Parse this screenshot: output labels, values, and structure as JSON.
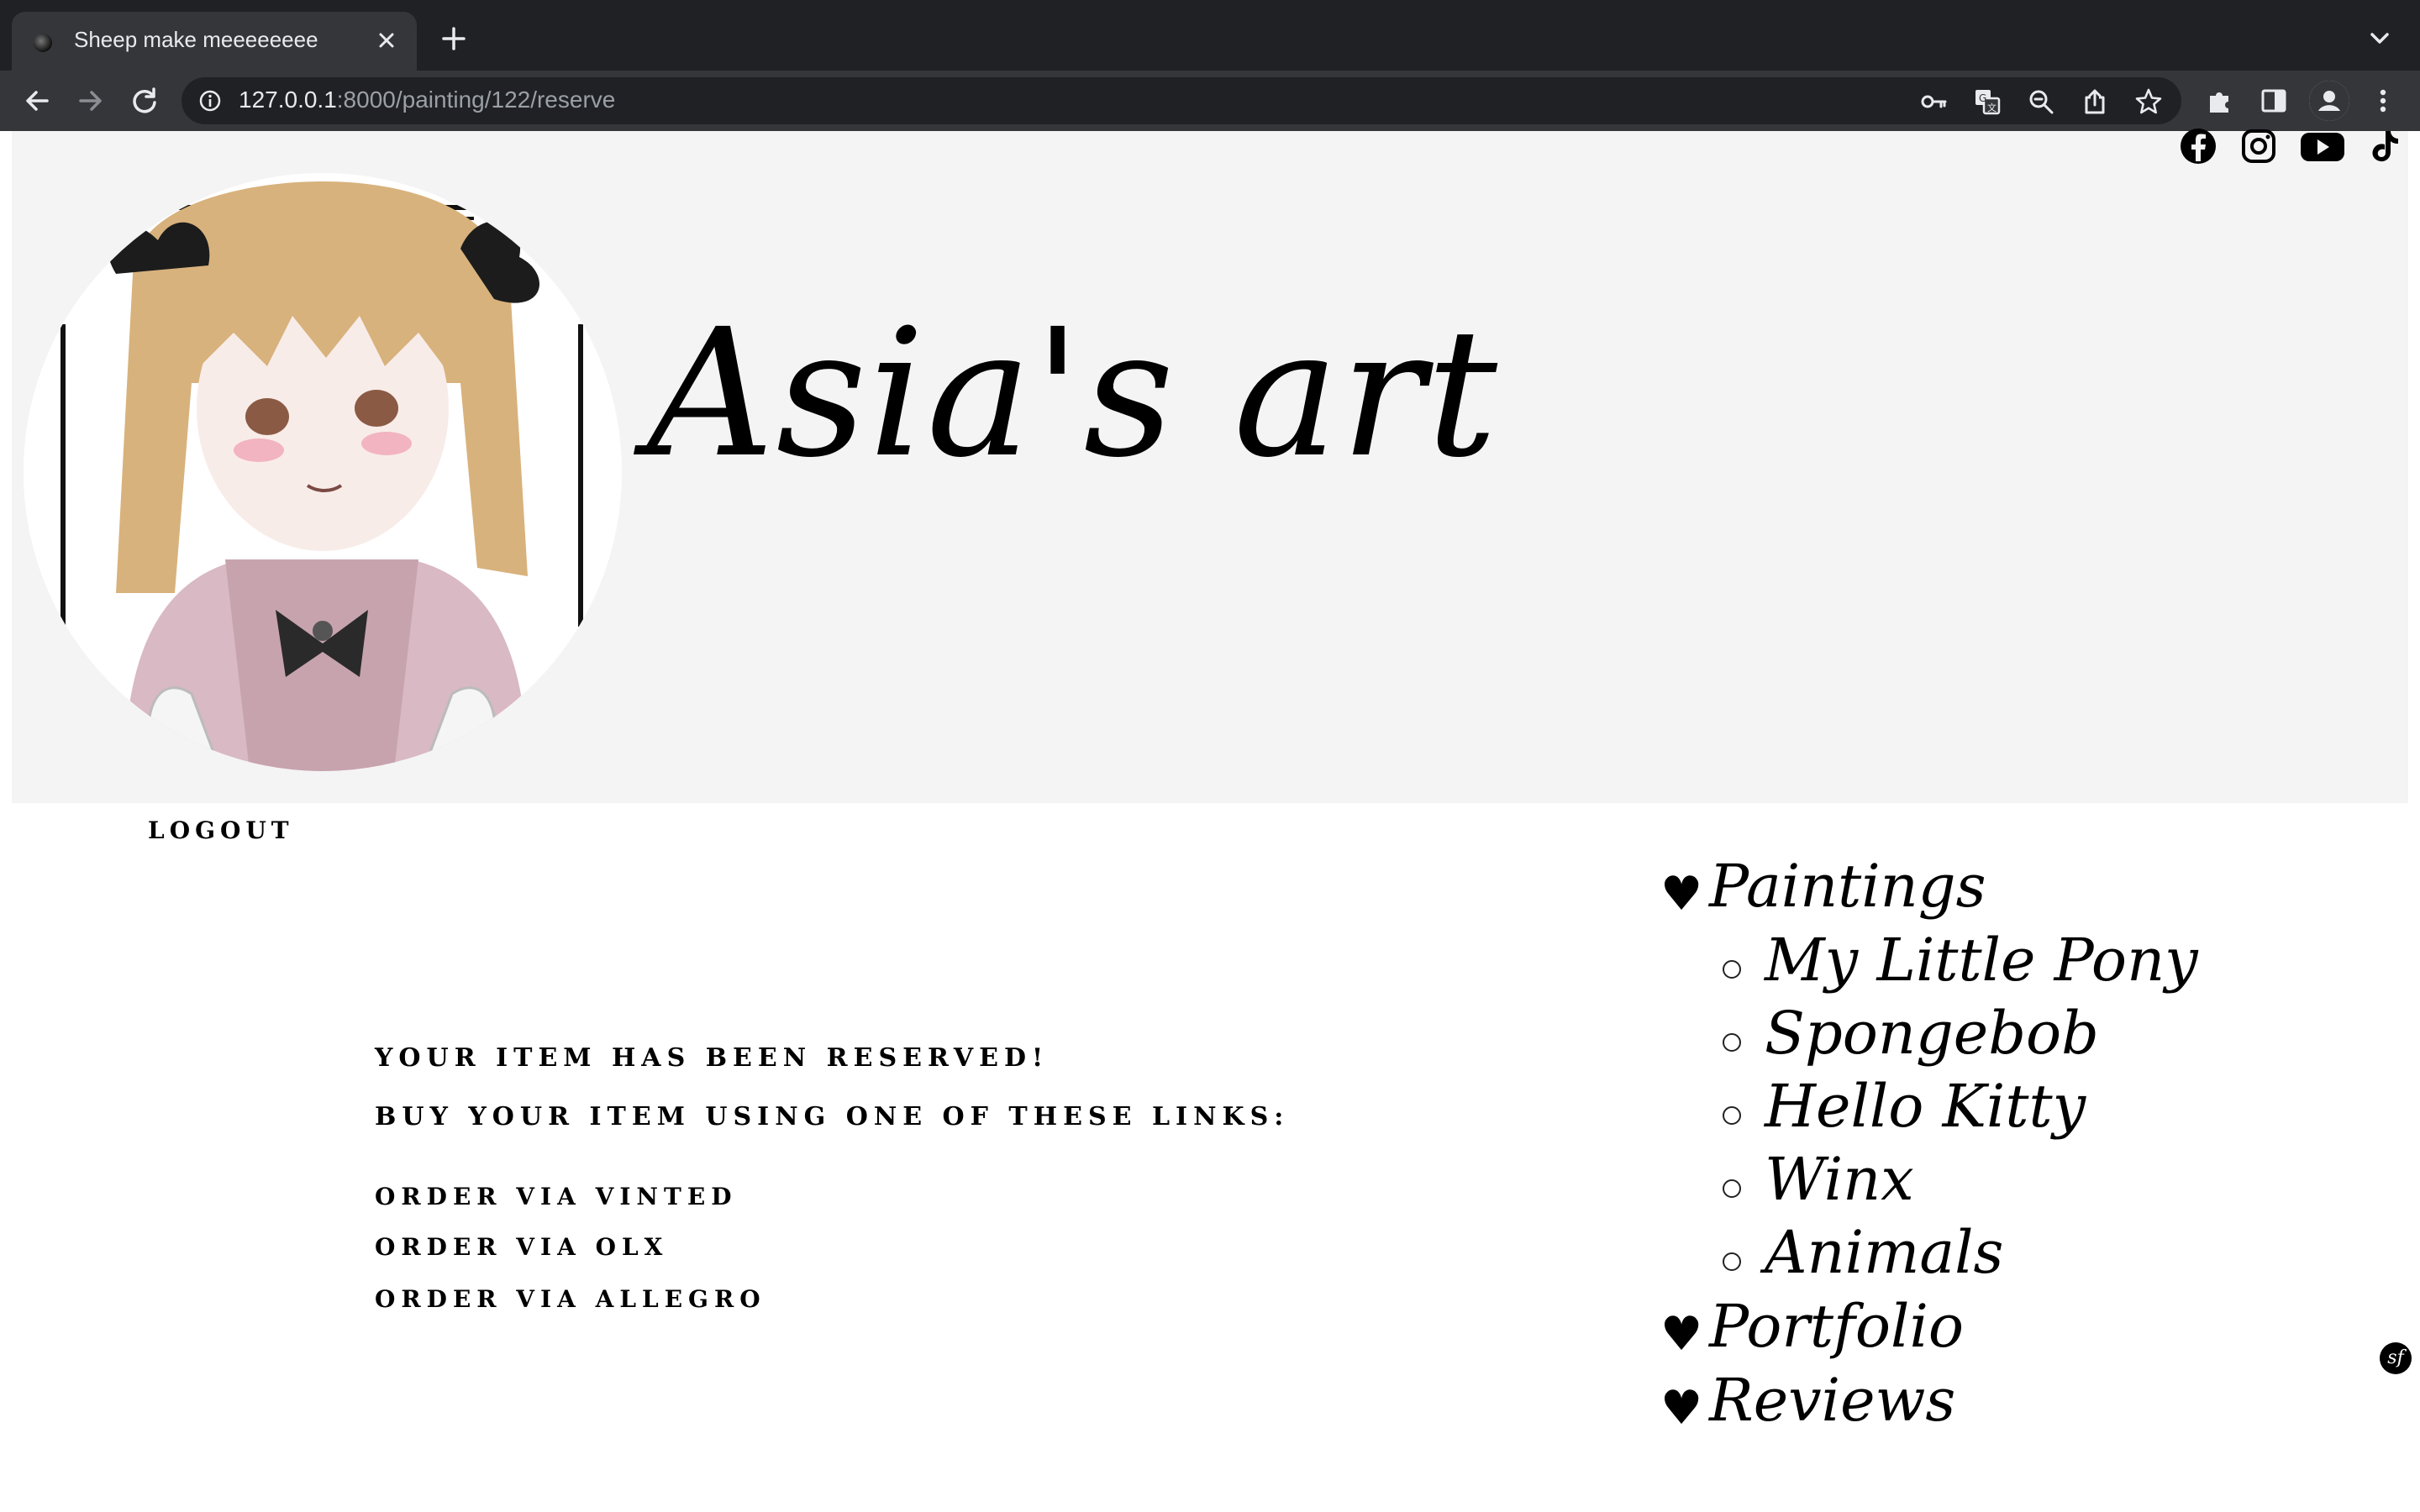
{
  "browser": {
    "tab": {
      "title": "Sheep make meeeeeeee",
      "favicon": "sheep-favicon-icon"
    },
    "url": {
      "host": "127.0.0.1",
      "path": ":8000/painting/122/reserve"
    },
    "icons": [
      "back-arrow-icon",
      "forward-arrow-icon",
      "reload-icon",
      "info-icon",
      "key-icon",
      "translate-icon",
      "zoom-out-icon",
      "share-icon",
      "star-icon",
      "puzzle-icon",
      "side-panel-icon",
      "profile-icon",
      "more-vert-icon",
      "close-icon",
      "plus-icon",
      "chevron-down-icon"
    ]
  },
  "header": {
    "site_title": "Asia's art",
    "social": [
      "facebook-icon",
      "instagram-icon",
      "youtube-icon",
      "tiktok-icon"
    ]
  },
  "auth": {
    "logout_label": "LOGOUT"
  },
  "main": {
    "reserved_message": "YOUR ITEM HAS BEEN RESERVED!",
    "links_intro": "BUY YOUR ITEM USING ONE OF THESE LINKS:",
    "order_links": [
      "ORDER VIA VINTED",
      "ORDER VIA OLX",
      "ORDER VIA ALLEGRO"
    ]
  },
  "menu": {
    "bullet": "♥",
    "items": [
      {
        "label": "Paintings",
        "subitems": [
          "My Little Pony",
          "Spongebob",
          "Hello Kitty",
          "Winx",
          "Animals"
        ]
      },
      {
        "label": "Portfolio"
      },
      {
        "label": "Reviews"
      }
    ]
  },
  "footer": {
    "badge": "sf"
  },
  "colors": {
    "chrome_dark": "#202124",
    "chrome_toolbar": "#35363a",
    "header_band": "#f4f4f4",
    "text": "#000000"
  }
}
